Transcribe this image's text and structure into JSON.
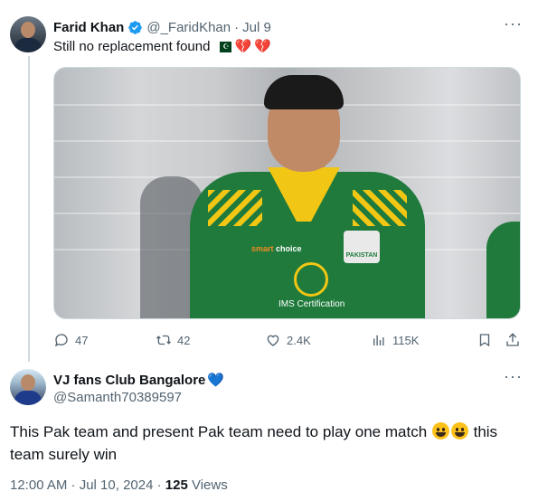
{
  "quoted_tweet": {
    "author_name": "Farid Khan",
    "handle": "@_FaridKhan",
    "separator": "·",
    "date": "Jul 9",
    "text": "Still no replacement found",
    "media_description_icons": [
      "pakistan-flag-icon",
      "broken-heart-icon",
      "broken-heart-icon"
    ],
    "media": {
      "jersey_sponsor_prefix": "smart",
      "jersey_sponsor": "choice",
      "jersey_badge": "PAKISTAN",
      "jersey_cert": "IMS Certification"
    },
    "stats": {
      "replies": "47",
      "retweets": "42",
      "likes": "2.4K",
      "views": "115K"
    }
  },
  "reply_tweet": {
    "author_name": "VJ fans Club Bangalore",
    "handle": "@Samanth70389597",
    "text_part1": "This Pak team and present Pak team need to play one match ",
    "text_part2": " this team surely win",
    "timestamp": "12:00 AM · Jul 10, 2024 · ",
    "views_count": "125",
    "views_label": " Views"
  },
  "colors": {
    "accent": "#1d9bf0",
    "text": "#0f1419",
    "secondary": "#536471",
    "jersey_green": "#1f7a3c",
    "jersey_yellow": "#f2c614"
  }
}
